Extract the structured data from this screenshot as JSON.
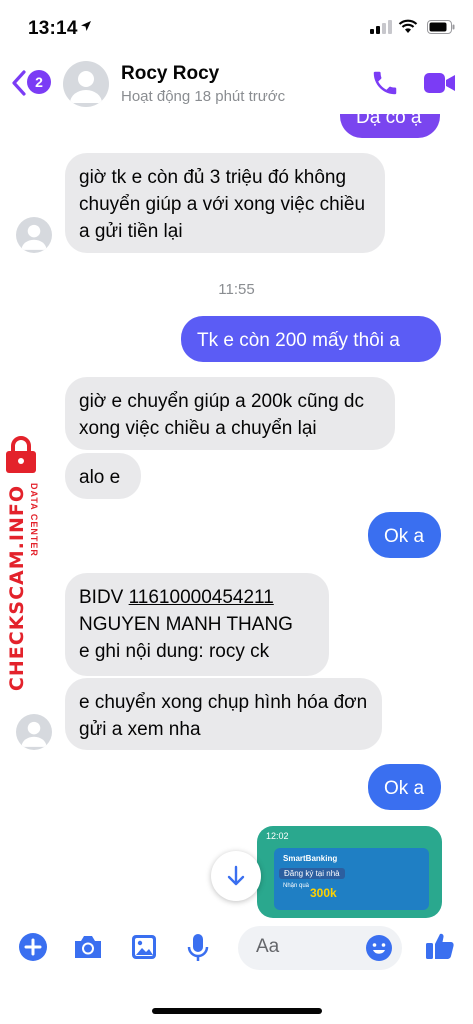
{
  "status_bar": {
    "time": "13:14"
  },
  "header": {
    "back_badge": "2",
    "contact_name": "Rocy Rocy",
    "contact_status": "Hoạt động 18 phút trước"
  },
  "messages": {
    "m0": "Dạ có ạ",
    "m1": "giờ tk e còn đủ 3 triệu đó không chuyển giúp a với xong việc chiều a gửi tiền lại",
    "time1": "11:55",
    "m2": "Tk e còn 200 mấy thôi a",
    "m3": "giờ e chuyển giúp a 200k cũng dc xong việc chiều a chuyển lại",
    "m4": "alo e",
    "m5": "Ok a",
    "m6_bank": "BIDV",
    "m6_account": "11610000454211",
    "m6_name": "NGUYEN MANH THANG",
    "m6_note": "e ghi nội dung: rocy ck",
    "m7": "e chuyển xong chụp hình hóa đơn gửi a xem nha",
    "m8": "Ok a"
  },
  "thumbnail": {
    "time": "12:02",
    "brand": "SmartBanking",
    "title": "Đăng ký tại nhà",
    "small": "Nhận quà",
    "amount": "300k"
  },
  "watermark": {
    "text": "CHECKSCAM.INFO",
    "sub": "DATA CENTER"
  },
  "composer": {
    "placeholder": "Aa"
  },
  "colors": {
    "accent": "#7b3cf5",
    "incoming": "#e9e9eb",
    "outgoing_purple": "#7a45ef",
    "outgoing_blue": "#3a6ff0",
    "watermark_red": "#e3222b"
  },
  "icons": [
    "location-arrow-icon",
    "signal-icon",
    "wifi-icon",
    "battery-icon",
    "back-chevron-icon",
    "phone-icon",
    "video-camera-icon",
    "arrow-down-icon",
    "plus-circle-icon",
    "camera-icon",
    "image-icon",
    "microphone-icon",
    "smile-icon",
    "thumbs-up-icon",
    "padlock-icon"
  ]
}
